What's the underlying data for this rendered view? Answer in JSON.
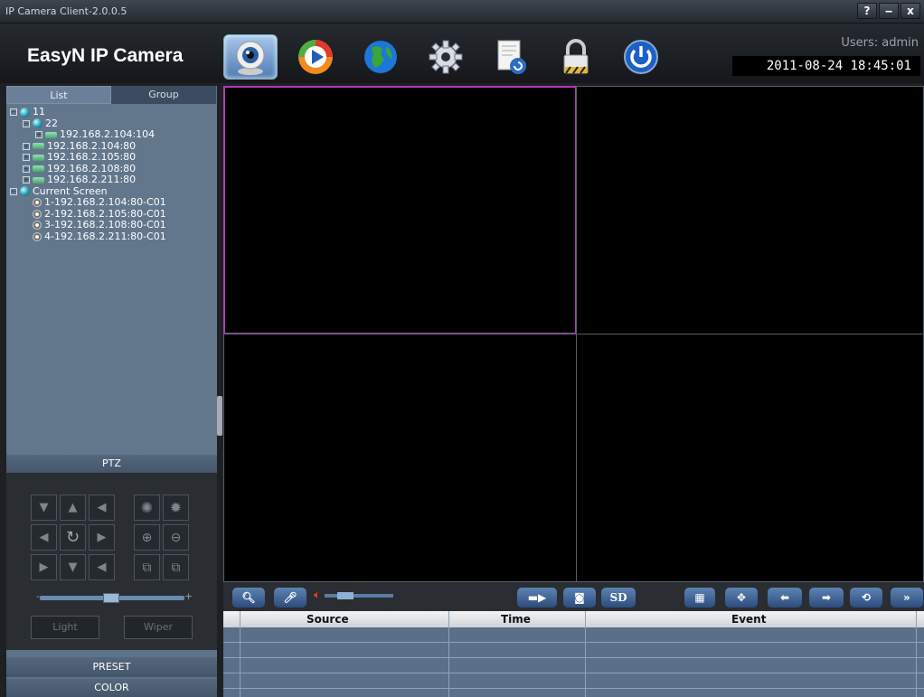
{
  "window": {
    "title": "IP Camera Client-2.0.0.5",
    "help_label": "?",
    "minimize_label": "‒",
    "close_label": "x"
  },
  "header": {
    "logo": "EasyN IP Camera",
    "users_label": "Users: admin",
    "datetime": "2011-08-24 18:45:01",
    "toolbar_icons": [
      "webcam-icon",
      "playback-icon",
      "globe-icon",
      "settings-gear-icon",
      "log-document-icon",
      "lock-icon",
      "power-icon"
    ]
  },
  "left_panel": {
    "tabs": [
      "List",
      "Group"
    ],
    "tree": [
      {
        "level": 0,
        "kind": "group",
        "label": "11",
        "pm": "−"
      },
      {
        "level": 1,
        "kind": "group",
        "label": "22",
        "pm": "−"
      },
      {
        "level": 2,
        "kind": "device",
        "label": "192.168.2.104:104",
        "pm": "+"
      },
      {
        "level": 1,
        "kind": "device",
        "label": "192.168.2.104:80",
        "pm": "+"
      },
      {
        "level": 1,
        "kind": "device",
        "label": "192.168.2.105:80",
        "pm": "+"
      },
      {
        "level": 1,
        "kind": "device",
        "label": "192.168.2.108:80",
        "pm": "+"
      },
      {
        "level": 1,
        "kind": "device",
        "label": "192.168.2.211:80",
        "pm": "+"
      },
      {
        "level": 0,
        "kind": "group",
        "label": "Current Screen",
        "pm": "−"
      },
      {
        "level": 1,
        "kind": "camera",
        "label": "1-192.168.2.104:80-C01",
        "pm": ""
      },
      {
        "level": 1,
        "kind": "camera",
        "label": "2-192.168.2.105:80-C01",
        "pm": ""
      },
      {
        "level": 1,
        "kind": "camera",
        "label": "3-192.168.2.108:80-C01",
        "pm": ""
      },
      {
        "level": 1,
        "kind": "camera",
        "label": "4-192.168.2.211:80-C01",
        "pm": ""
      }
    ],
    "ptz_label": "PTZ",
    "slider_minus": "-",
    "slider_plus": "+",
    "light_label": "Light",
    "wiper_label": "Wiper",
    "preset_label": "PRESET",
    "color_label": "COLOR"
  },
  "bottom_toolbar": {
    "sd_label": "SD"
  },
  "events": {
    "columns": [
      "Source",
      "Time",
      "Event"
    ],
    "rows": []
  },
  "colors": {
    "selected_border": "#b03cb6",
    "accent": "#5d83b3"
  }
}
